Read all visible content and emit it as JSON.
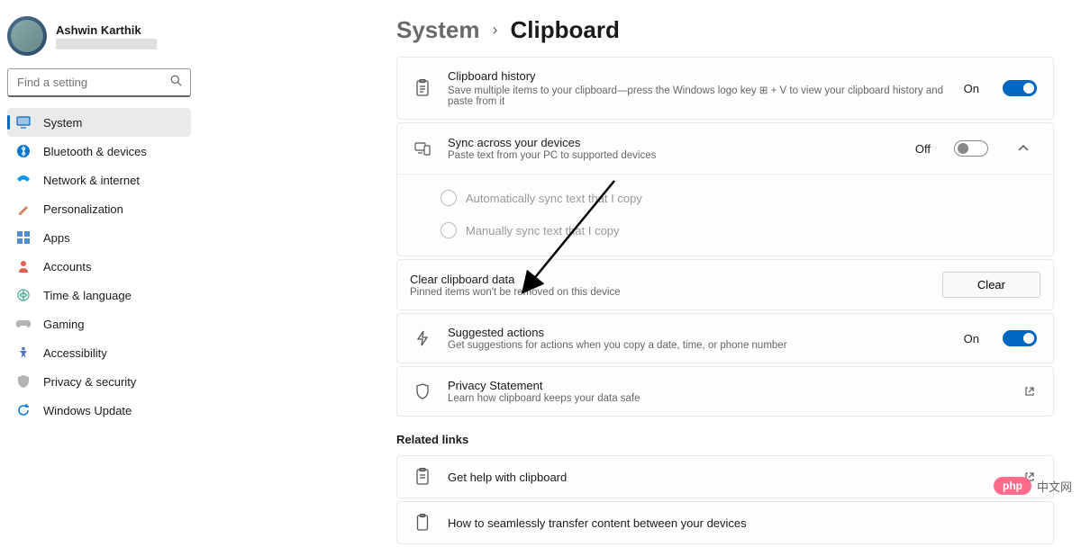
{
  "user": {
    "name": "Ashwin Karthik"
  },
  "search": {
    "placeholder": "Find a setting"
  },
  "nav": {
    "items": [
      {
        "label": "System",
        "icon": "system",
        "active": true
      },
      {
        "label": "Bluetooth & devices",
        "icon": "bluetooth"
      },
      {
        "label": "Network & internet",
        "icon": "network"
      },
      {
        "label": "Personalization",
        "icon": "personalization"
      },
      {
        "label": "Apps",
        "icon": "apps"
      },
      {
        "label": "Accounts",
        "icon": "accounts"
      },
      {
        "label": "Time & language",
        "icon": "time"
      },
      {
        "label": "Gaming",
        "icon": "gaming"
      },
      {
        "label": "Accessibility",
        "icon": "accessibility"
      },
      {
        "label": "Privacy & security",
        "icon": "privacy"
      },
      {
        "label": "Windows Update",
        "icon": "update"
      }
    ]
  },
  "breadcrumb": {
    "parent": "System",
    "current": "Clipboard"
  },
  "clipboard_history": {
    "title": "Clipboard history",
    "sub": "Save multiple items to your clipboard—press the Windows logo key ⊞ + V to view your clipboard history and paste from it",
    "state": "On"
  },
  "sync_devices": {
    "title": "Sync across your devices",
    "sub": "Paste text from your PC to supported devices",
    "state": "Off",
    "option_auto": "Automatically sync text that I copy",
    "option_manual": "Manually sync text that I copy"
  },
  "clear_data": {
    "title": "Clear clipboard data",
    "sub": "Pinned items won't be removed on this device",
    "button": "Clear"
  },
  "suggested": {
    "title": "Suggested actions",
    "sub": "Get suggestions for actions when you copy a date, time, or phone number",
    "state": "On"
  },
  "privacy": {
    "title": "Privacy Statement",
    "sub": "Learn how clipboard keeps your data safe"
  },
  "related": {
    "heading": "Related links",
    "help": "Get help with clipboard",
    "transfer": "How to seamlessly transfer content between your devices"
  },
  "watermark": {
    "pill": "php",
    "text": "中文网"
  }
}
